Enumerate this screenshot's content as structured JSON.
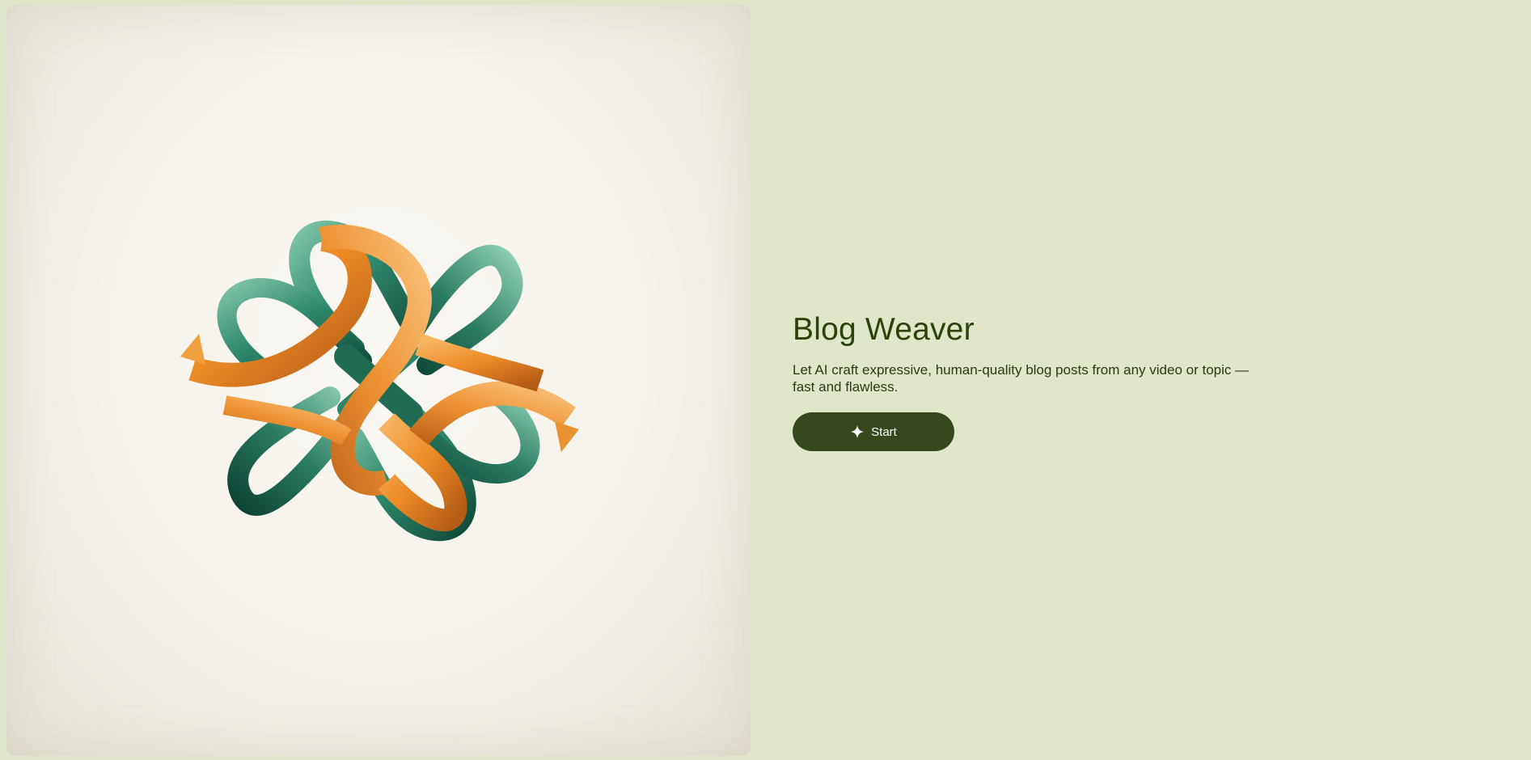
{
  "hero": {
    "image_alt": "Interwoven green and orange ribbon knot illustration",
    "colors": {
      "ribbon_green": "#2f8a6e",
      "ribbon_orange": "#ef9a34"
    }
  },
  "main": {
    "title": "Blog Weaver",
    "description": "Let AI craft expressive, human-quality blog posts from any video or topic — fast and flawless.",
    "start_button": {
      "label": "Start",
      "icon": "sparkle-icon"
    }
  },
  "colors": {
    "background": "#dfe7c8",
    "title": "#2b4208",
    "button": "#38481d"
  }
}
